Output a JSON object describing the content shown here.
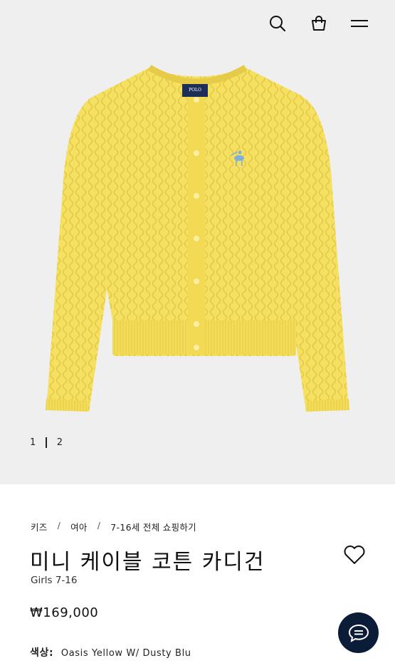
{
  "header": {
    "icons": [
      "search-icon",
      "shopping-bag-icon",
      "menu-icon"
    ]
  },
  "gallery": {
    "pages": [
      "1",
      "2"
    ],
    "active_page": "1",
    "background": "#efefef",
    "garment_color": "#f6e062",
    "accent_color": "#7fb1d6",
    "label_text": "POLO"
  },
  "breadcrumb": [
    "키즈",
    "여아",
    "7-16세 전체 쇼핑하기"
  ],
  "product": {
    "title": "미니 케이블 코튼 카디건",
    "subtitle": "Girls 7-16",
    "price": "₩169,000",
    "color_label": "색상:",
    "color_value": "Oasis Yellow W/ Dusty Blu"
  },
  "chat": {
    "color": "#0b1c39",
    "icon": "chat-icon"
  }
}
